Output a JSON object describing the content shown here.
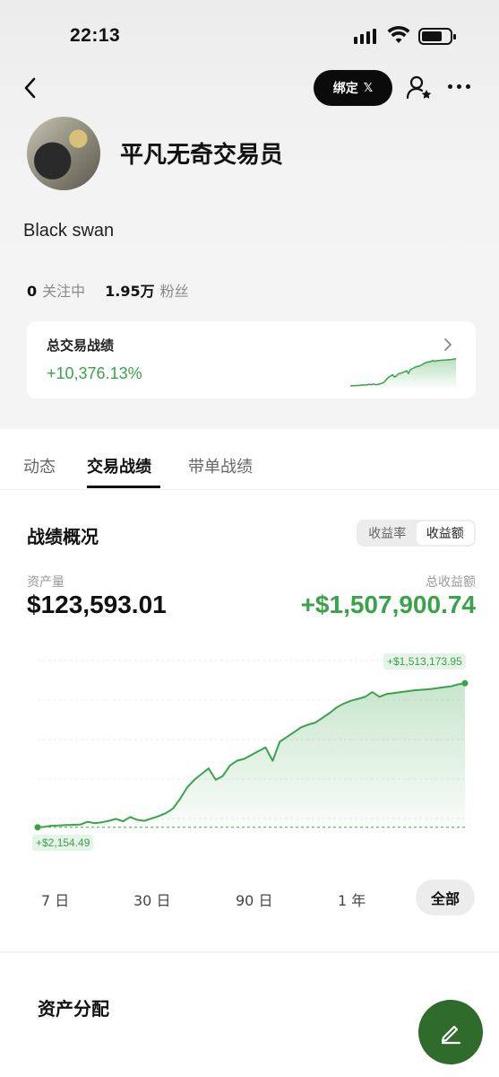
{
  "status_bar": {
    "time": "22:13"
  },
  "top_nav": {
    "bind_label": "绑定",
    "bind_x_glyph": "𝕏"
  },
  "profile": {
    "username": "平凡无奇交易员",
    "bio": "Black swan",
    "following_count": "0",
    "following_label": "关注中",
    "followers_count": "1.95万",
    "followers_label": "粉丝"
  },
  "total_perf_card": {
    "title": "总交易战绩",
    "value": "+10,376.13%"
  },
  "tabs": [
    {
      "label": "动态",
      "active": false
    },
    {
      "label": "交易战绩",
      "active": true
    },
    {
      "label": "带单战绩",
      "active": false
    }
  ],
  "overview": {
    "title": "战绩概况",
    "toggle_options": [
      "收益率",
      "收益额"
    ],
    "toggle_selected": "收益额",
    "assets_label": "资产量",
    "assets_value": "$123,593.01",
    "pnl_label": "总收益额",
    "pnl_value": "+$1,507,900.74"
  },
  "chart_data": {
    "type": "area",
    "color": "#3aa34a",
    "start_label": "+$2,154.49",
    "end_label": "+$1,513,173.95",
    "x": [
      0,
      1,
      2,
      3,
      4,
      5,
      6,
      7,
      8,
      9,
      10,
      11,
      12,
      13,
      14,
      15,
      16,
      17,
      18,
      19,
      20,
      21,
      22,
      23,
      24,
      25,
      26,
      27,
      28,
      29,
      30,
      31,
      32,
      33,
      34,
      35,
      36,
      37,
      38,
      39,
      40,
      41,
      42,
      43,
      44,
      45,
      46,
      47,
      48,
      49,
      50,
      51,
      52,
      53,
      54,
      55,
      56,
      57,
      58,
      59,
      60
    ],
    "values": [
      2154,
      8000,
      20000,
      22000,
      25000,
      28000,
      30000,
      60000,
      45000,
      55000,
      70000,
      90000,
      65000,
      110000,
      80000,
      70000,
      95000,
      120000,
      150000,
      200000,
      300000,
      420000,
      500000,
      560000,
      620000,
      500000,
      540000,
      650000,
      700000,
      720000,
      760000,
      800000,
      840000,
      700000,
      900000,
      950000,
      1000000,
      1050000,
      1080000,
      1100000,
      1150000,
      1200000,
      1260000,
      1300000,
      1330000,
      1350000,
      1370000,
      1420000,
      1370000,
      1400000,
      1410000,
      1420000,
      1430000,
      1440000,
      1445000,
      1450000,
      1460000,
      1470000,
      1480000,
      1500000,
      1513174
    ],
    "ylim": [
      0,
      1600000
    ]
  },
  "range_options": [
    "7 日",
    "30 日",
    "90 日",
    "1 年",
    "全部"
  ],
  "range_selected": "全部",
  "allocation": {
    "title": "资产分配"
  }
}
